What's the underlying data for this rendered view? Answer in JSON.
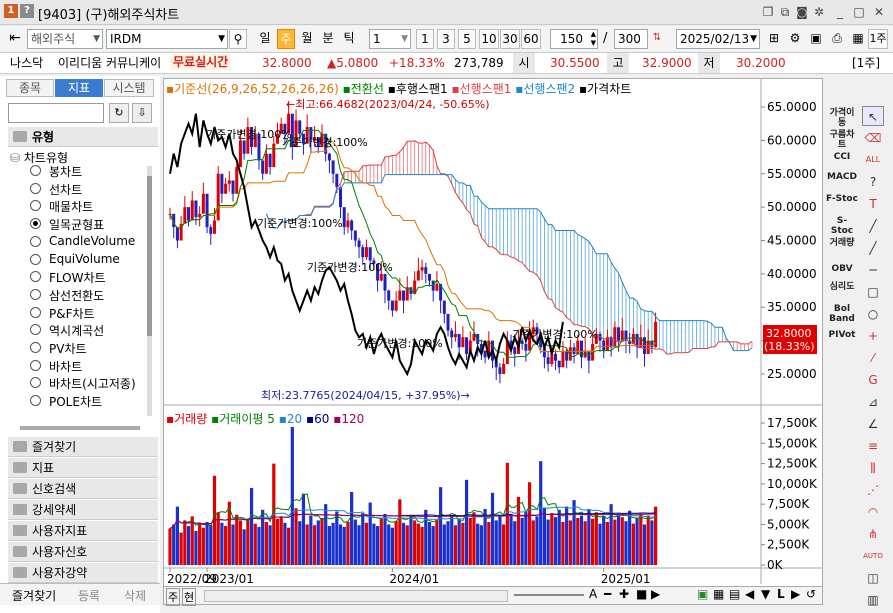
{
  "window": {
    "title": "[9403] (구)해외주식차트",
    "icons": [
      "help-icon",
      "restore-icon",
      "copy-icon",
      "camera-icon",
      "settings-icon",
      "minimize-icon",
      "maximize-icon",
      "close-icon"
    ]
  },
  "toolbar": {
    "market": "해외주식",
    "symbol": "IRDM",
    "periods": [
      "일",
      "주",
      "월",
      "분",
      "틱"
    ],
    "active_period": "주",
    "interval_select": "1",
    "intervals": [
      "1",
      "3",
      "5",
      "10",
      "30",
      "60"
    ],
    "count_value": "150",
    "total_value": "300",
    "date": "2025/02/13",
    "unit_label": "1주"
  },
  "quote": {
    "exchange": "나스닥",
    "name": "이리디움 커뮤니케이",
    "realtime": "무료실시간",
    "price": "32.8000",
    "change": "▲5.0800",
    "change_pct": "+18.33%",
    "volume": "273,789",
    "open_label": "시",
    "open": "30.5500",
    "high_label": "고",
    "high": "32.9000",
    "low_label": "저",
    "low": "30.2000",
    "badge": "[1주]"
  },
  "left_panel": {
    "tabs": [
      "종목",
      "지표",
      "시스템"
    ],
    "active_tab": "지표",
    "section": "유형",
    "tree_root": "차트유형",
    "chart_types": [
      "봉차트",
      "선차트",
      "매물차트",
      "일목균형표",
      "CandleVolume",
      "EquiVolume",
      "FLOW차트",
      "삼선전환도",
      "P&F차트",
      "역시계곡선",
      "PV차트",
      "바차트",
      "바차트(시고저종)",
      "POLE차트"
    ],
    "selected_type": "일목균형표",
    "groups": [
      "즐겨찾기",
      "지표",
      "신호검색",
      "강세약세",
      "사용자지표",
      "사용자신호",
      "사용자강약"
    ],
    "bottom_tabs": [
      "즐겨찾기",
      "등록",
      "삭제"
    ]
  },
  "chart_data": [
    {
      "type": "line",
      "legend": [
        "기준선(26,9,26,52,26,26,26)",
        "전환선",
        "후행스팬1",
        "선행스팬1",
        "선행스팬2",
        "가격차트"
      ],
      "colors": {
        "base": "#e07000",
        "conv": "#008000",
        "lag": "#000000",
        "span1": "#e04040",
        "span2": "#1e88c8",
        "price": "#2020c0",
        "up": "#e00000"
      },
      "ylim": [
        22,
        68
      ],
      "y_ticks": [
        "65.0000",
        "60.0000",
        "55.0000",
        "50.0000",
        "45.0000",
        "40.0000",
        "35.0000",
        "30.0000",
        "25.0000"
      ],
      "current_label": "32.8000",
      "current_pct_label": "(18.33%)",
      "annotations": {
        "high": "←최고:66.4682(2023/04/24, -50.65%)",
        "low": "최저:23.7765(2024/04/15, +37.95%)→",
        "base_change": "기준가변경:100%"
      },
      "series": {
        "price": [
          49.0,
          47.0,
          45.0,
          47.5,
          50.0,
          48.0,
          51.0,
          48.5,
          49.0,
          52.0,
          47.0,
          46.0,
          48.0,
          55.0,
          52.0,
          53.5,
          54.0,
          52.0,
          56.0,
          60.0,
          58.0,
          62.0,
          59.0,
          61.0,
          57.0,
          55.0,
          58.0,
          56.0,
          59.5,
          61.0,
          62.5,
          61.0,
          64.0,
          59.0,
          63.0,
          61.0,
          59.5,
          62.0,
          60.0,
          60.5,
          59.0,
          61.0,
          58.0,
          57.0,
          55.0,
          53.0,
          50.0,
          47.0,
          48.0,
          46.5,
          45.0,
          44.0,
          42.5,
          44.0,
          42.0,
          41.5,
          39.0,
          40.0,
          37.5,
          36.0,
          34.5,
          36.0,
          37.5,
          36.0,
          38.0,
          37.0,
          39.0,
          40.5,
          41.0,
          40.0,
          39.0,
          37.5,
          38.5,
          36.0,
          34.0,
          31.5,
          30.5,
          31.0,
          29.0,
          30.5,
          28.0,
          30.0,
          31.0,
          29.5,
          28.5,
          27.5,
          30.0,
          27.0,
          26.0,
          25.0,
          26.5,
          30.0,
          29.0,
          28.0,
          30.0,
          29.5,
          28.5,
          31.0,
          32.0,
          31.0,
          29.0,
          27.5,
          26.5,
          28.0,
          27.0,
          26.0,
          28.5,
          27.0,
          29.0,
          28.0,
          30.0,
          27.5,
          28.5,
          27.0,
          29.5,
          31.0,
          30.0,
          28.5,
          30.5,
          29.0,
          32.0,
          30.0,
          31.5,
          30.0,
          29.5,
          31.0,
          29.0,
          30.5,
          28.0,
          30.0,
          29.0,
          32.8
        ],
        "volume": [
          4.5,
          5.0,
          7.2,
          4.0,
          5.5,
          4.8,
          6.0,
          4.2,
          5.1,
          4.6,
          5.3,
          4.9,
          11.0,
          6.5,
          5.2,
          4.8,
          7.8,
          5.0,
          6.2,
          5.5,
          4.4,
          5.6,
          9.5,
          5.1,
          4.7,
          6.8,
          5.3,
          4.9,
          12.5,
          5.7,
          6.0,
          5.2,
          4.6,
          17.5,
          7.0,
          5.4,
          8.8,
          5.0,
          6.1,
          4.9,
          5.5,
          5.8,
          7.5,
          4.8,
          5.2,
          6.6,
          5.0,
          4.7,
          5.3,
          9.0,
          5.6,
          4.9,
          6.4,
          5.2,
          7.7,
          5.1,
          4.8,
          5.7,
          6.3,
          5.0,
          4.6,
          5.4,
          8.1,
          5.2,
          4.9,
          6.0,
          5.5,
          5.1,
          4.7,
          6.8,
          5.3,
          4.8,
          5.6,
          9.6,
          5.0,
          5.4,
          6.1,
          4.9,
          5.7,
          5.2,
          10.5,
          5.8,
          6.5,
          5.1,
          4.9,
          6.9,
          5.3,
          8.9,
          5.5,
          6.2,
          5.0,
          12.6,
          6.3,
          5.4,
          8.4,
          5.8,
          6.6,
          10.2,
          5.5,
          6.0,
          12.8,
          7.0,
          5.6,
          6.4,
          5.9,
          6.8,
          5.3,
          7.2,
          5.5,
          8.0,
          5.8,
          6.1,
          5.4,
          6.9,
          5.7,
          6.5,
          5.1,
          6.0,
          5.3,
          7.5,
          5.6,
          6.2,
          5.9,
          5.4,
          6.7,
          5.1,
          5.8,
          6.3,
          5.0,
          6.1,
          5.5,
          7.2,
          5.8,
          6.4,
          6.0,
          3.9
        ]
      },
      "x_labels": [
        "2022/09",
        "2023/01",
        "2024/01",
        "2025/01"
      ]
    },
    {
      "type": "bar",
      "legend": [
        "거래량",
        "거래이평",
        "5",
        "20",
        "60",
        "120"
      ],
      "y_ticks": [
        "17,500K",
        "15,000K",
        "12,500K",
        "10,000K",
        "7,500K",
        "5,000K",
        "2,500K",
        "0K"
      ],
      "ylim": [
        0,
        18
      ],
      "units": "K (thousands)"
    }
  ],
  "bottom_bar": {
    "labels": [
      "주",
      "현"
    ]
  },
  "right_toolbar": {
    "items": [
      "가격이동",
      "구름차트",
      "CCI",
      "MACD",
      "F-Stoc",
      "S-Stoc",
      "거래량",
      "OBV",
      "심리도",
      "Bol Band",
      "PIVot"
    ]
  }
}
